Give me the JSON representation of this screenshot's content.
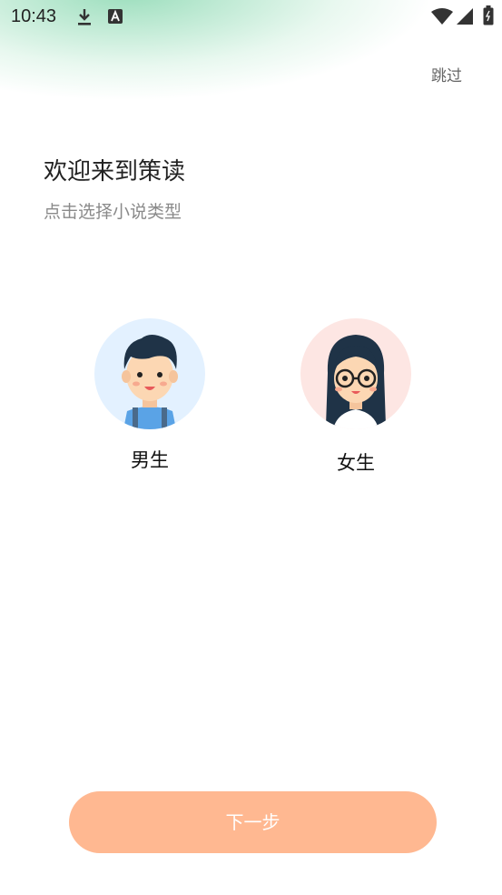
{
  "status_bar": {
    "time": "10:43",
    "icons": [
      "download-icon",
      "a-notification-icon",
      "wifi-icon",
      "signal-icon",
      "battery-icon"
    ]
  },
  "header": {
    "skip_label": "跳过"
  },
  "intro": {
    "title": "欢迎来到策读",
    "subtitle": "点击选择小说类型"
  },
  "genders": [
    {
      "label": "男生",
      "avatar": "boy-avatar",
      "bg": "#e3f1ff"
    },
    {
      "label": "女生",
      "avatar": "girl-avatar",
      "bg": "#fde6e3"
    }
  ],
  "footer": {
    "next_label": "下一步"
  },
  "colors": {
    "accent": "#ffb891",
    "header_gradient": "#78d2a5"
  }
}
